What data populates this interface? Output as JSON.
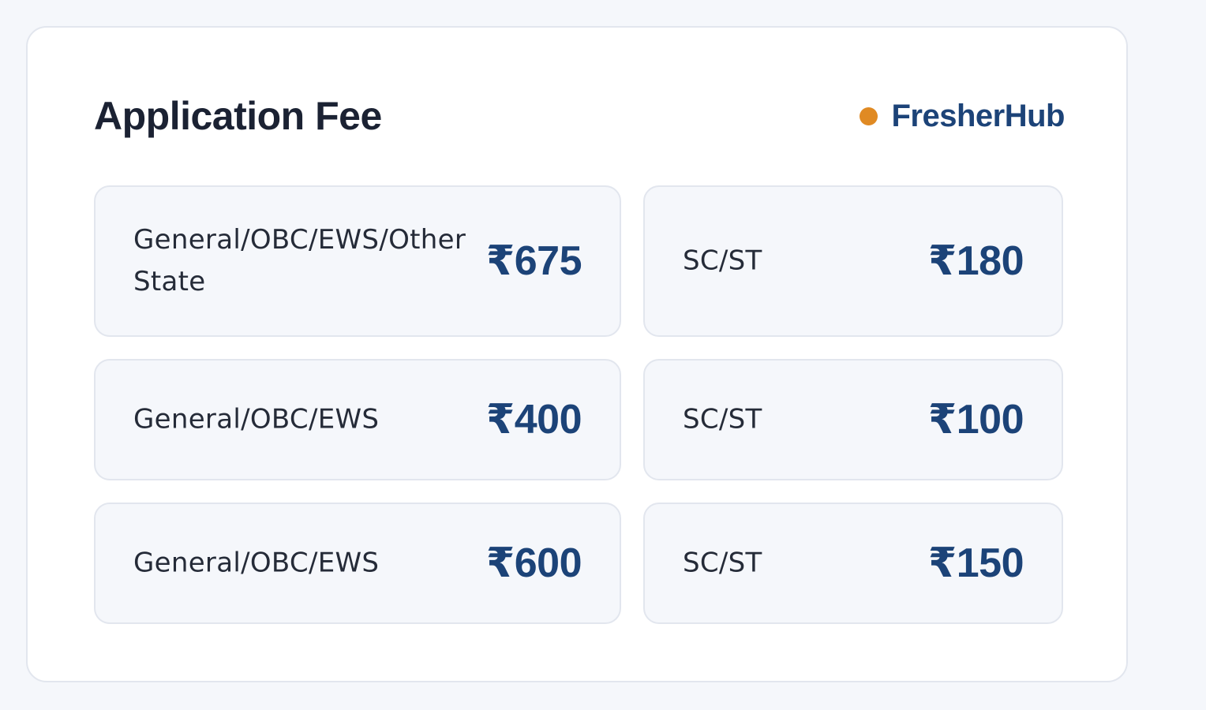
{
  "card": {
    "title": "Application Fee",
    "brand": "FresherHub"
  },
  "colors": {
    "background": "#f5f7fb",
    "accent_dot": "#e08a23",
    "brand_text": "#1c4378",
    "amount_text": "#1c4378",
    "label_text": "#252b38"
  },
  "fees": [
    {
      "category": "General/OBC/EWS/Other State",
      "amount": "₹675"
    },
    {
      "category": "SC/ST",
      "amount": "₹180"
    },
    {
      "category": "General/OBC/EWS",
      "amount": "₹400"
    },
    {
      "category": "SC/ST",
      "amount": "₹100"
    },
    {
      "category": "General/OBC/EWS",
      "amount": "₹600"
    },
    {
      "category": "SC/ST",
      "amount": "₹150"
    }
  ]
}
